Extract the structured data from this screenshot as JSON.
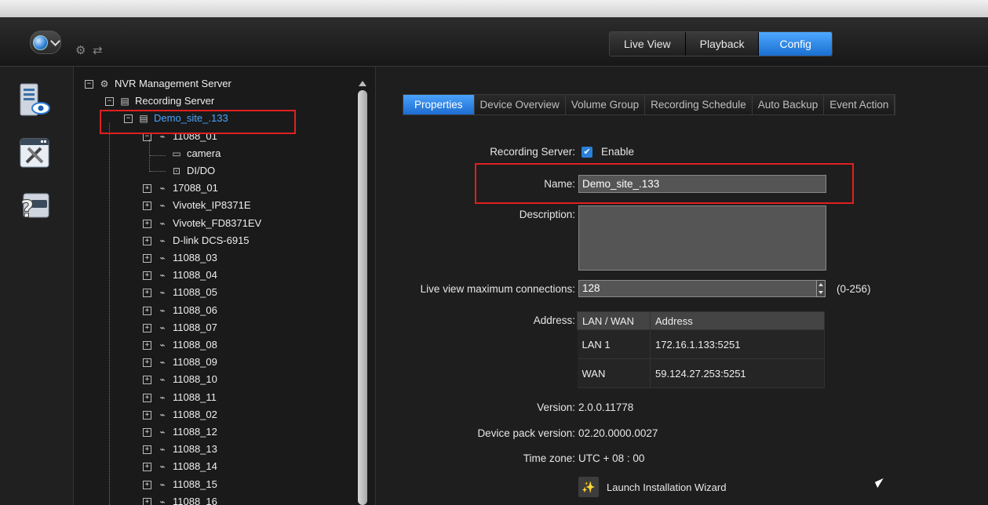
{
  "topbar": {
    "modes": [
      {
        "label": "Live View",
        "active": false
      },
      {
        "label": "Playback",
        "active": false
      },
      {
        "label": "Config",
        "active": true
      }
    ]
  },
  "leftrail": {
    "icons": [
      "server-monitor-icon",
      "tools-config-icon",
      "help-icon"
    ]
  },
  "tree": {
    "root": "NVR Management Server",
    "recording_server": "Recording Server",
    "selected_site": "Demo_site_.133",
    "expanded_device": "11088_01",
    "device_children": [
      "camera",
      "DI/DO"
    ],
    "devices": [
      "17088_01",
      "Vivotek_IP8371E",
      "Vivotek_FD8371EV",
      "D-link DCS-6915",
      "11088_03",
      "11088_04",
      "11088_05",
      "11088_06",
      "11088_07",
      "11088_08",
      "11088_09",
      "11088_10",
      "11088_11",
      "11088_02",
      "11088_12",
      "11088_13",
      "11088_14",
      "11088_15",
      "11088_16"
    ]
  },
  "tabs": [
    "Properties",
    "Device Overview",
    "Volume Group",
    "Recording Schedule",
    "Auto Backup",
    "Event Action"
  ],
  "form": {
    "recording_server_label": "Recording Server:",
    "enable_label": "Enable",
    "enabled": true,
    "name_label": "Name:",
    "name_value": "Demo_site_.133",
    "description_label": "Description:",
    "description_value": "",
    "live_max_label": "Live view maximum connections:",
    "live_max_value": "128",
    "live_max_range": "(0-256)",
    "address_label": "Address:",
    "address_headers": [
      "LAN / WAN",
      "Address"
    ],
    "address_rows": [
      {
        "type": "LAN 1",
        "address": "172.16.1.133:5251"
      },
      {
        "type": "WAN",
        "address": "59.124.27.253:5251"
      }
    ],
    "version_label": "Version:",
    "version_value": "2.0.0.11778",
    "device_pack_label": "Device pack version:",
    "device_pack_value": "02.20.0000.0027",
    "timezone_label": "Time zone:",
    "timezone_value": "UTC + 08 : 00",
    "wizard_label": "Launch Installation Wizard"
  },
  "colors": {
    "accent": "#2a7fd8",
    "highlight_box": "#e02020",
    "selected_text": "#49a4ff"
  }
}
